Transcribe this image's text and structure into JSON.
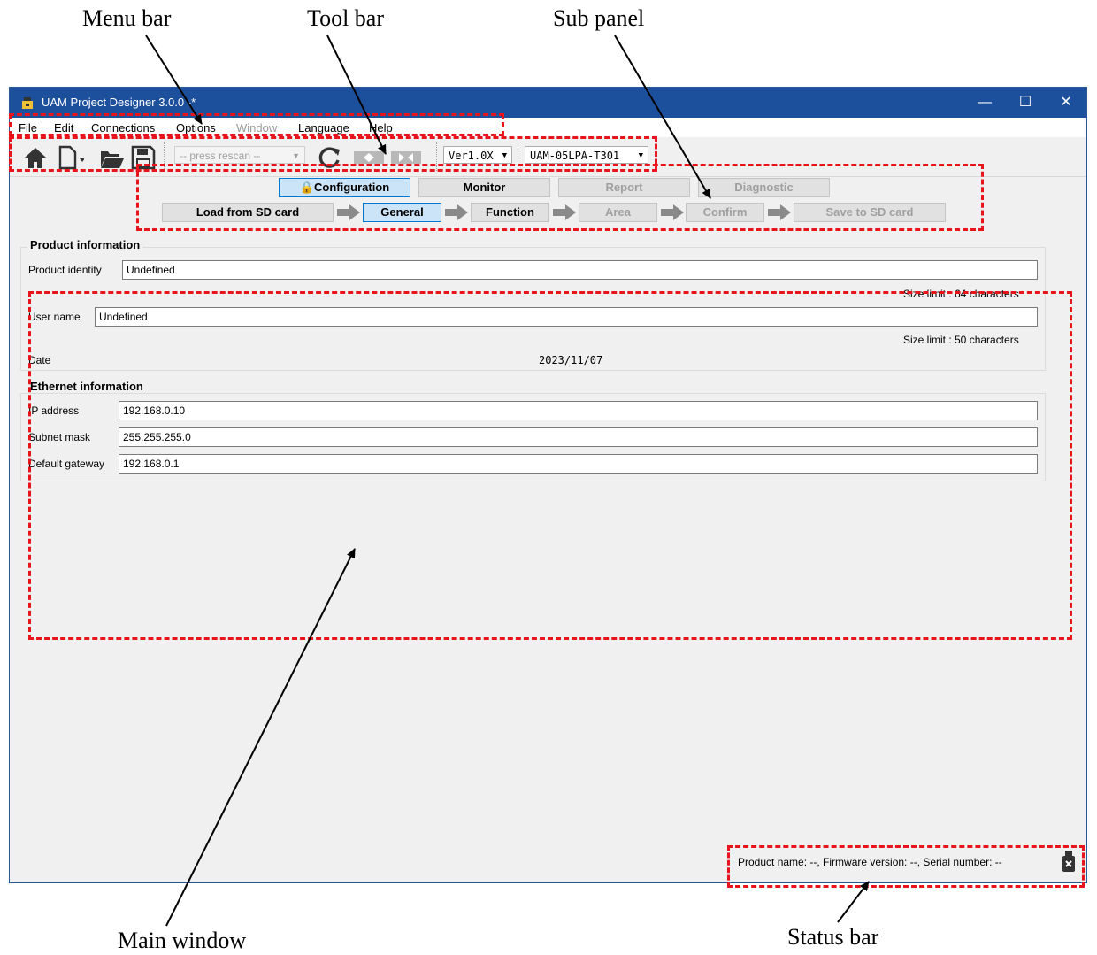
{
  "annotations": {
    "menu_bar": "Menu bar",
    "tool_bar": "Tool bar",
    "sub_panel": "Sub panel",
    "main_window": "Main window",
    "status_bar": "Status bar"
  },
  "window": {
    "title": "UAM Project Designer 3.0.0 -*",
    "controls": {
      "minimize": "—",
      "maximize": "☐",
      "close": "✕"
    }
  },
  "menu": {
    "items": [
      {
        "label": "File",
        "enabled": true
      },
      {
        "label": "Edit",
        "enabled": true
      },
      {
        "label": "Connections",
        "enabled": true
      },
      {
        "label": "Options",
        "enabled": true
      },
      {
        "label": "Window",
        "enabled": false
      },
      {
        "label": "Language",
        "enabled": true
      },
      {
        "label": "Help",
        "enabled": true
      }
    ]
  },
  "toolbar": {
    "port_combo": "-- press rescan --",
    "version_combo": "Ver1.0X",
    "model_combo": "UAM-05LPA-T301",
    "icons": [
      "home-icon",
      "new-file-icon",
      "open-folder-icon",
      "save-icon",
      "rescan-icon",
      "connect-icon",
      "disconnect-icon"
    ]
  },
  "sub_panel": {
    "modes": [
      {
        "label": "Configuration",
        "state": "active"
      },
      {
        "label": "Monitor",
        "state": "normal"
      },
      {
        "label": "Report",
        "state": "disabled"
      },
      {
        "label": "Diagnostic",
        "state": "disabled"
      }
    ],
    "steps": [
      {
        "label": "Load from SD card",
        "state": "normal"
      },
      {
        "label": "General",
        "state": "active"
      },
      {
        "label": "Function",
        "state": "normal"
      },
      {
        "label": "Area",
        "state": "disabled"
      },
      {
        "label": "Confirm",
        "state": "disabled"
      },
      {
        "label": "Save to SD card",
        "state": "disabled"
      }
    ]
  },
  "product_info": {
    "title": "Product information",
    "identity_label": "Product identity",
    "identity_value": "Undefined",
    "identity_limit": "Size limit : 64 characters",
    "user_label": "User name",
    "user_value": "Undefined",
    "user_limit": "Size limit : 50 characters",
    "date_label": "Date",
    "date_value": "2023/11/07"
  },
  "ethernet_info": {
    "title": "Ethernet information",
    "ip_label": "IP address",
    "ip_value": "192.168.0.10",
    "mask_label": "Subnet mask",
    "mask_value": "255.255.255.0",
    "gateway_label": "Default gateway",
    "gateway_value": "192.168.0.1"
  },
  "status_bar": {
    "text": "Product name: --, Firmware version: --, Serial number: --",
    "icon": "usb-disconnected-icon"
  },
  "colors": {
    "accent": "#0078d7",
    "annotation": "#e8141b",
    "titlebar": "#1c4f9c"
  }
}
